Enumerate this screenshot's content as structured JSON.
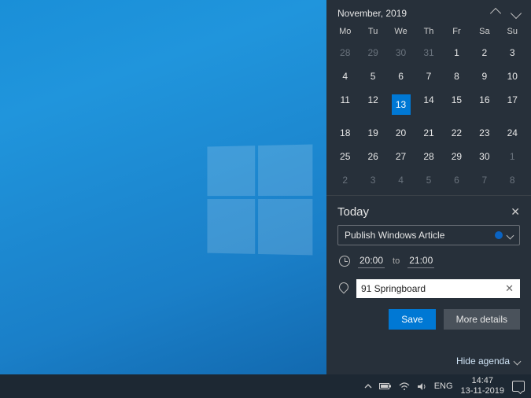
{
  "calendar": {
    "month_label": "November, 2019",
    "dow": [
      "Mo",
      "Tu",
      "We",
      "Th",
      "Fr",
      "Sa",
      "Su"
    ],
    "weeks": [
      [
        {
          "n": 28,
          "dim": true
        },
        {
          "n": 29,
          "dim": true
        },
        {
          "n": 30,
          "dim": true
        },
        {
          "n": 31,
          "dim": true
        },
        {
          "n": 1
        },
        {
          "n": 2
        },
        {
          "n": 3
        }
      ],
      [
        {
          "n": 4
        },
        {
          "n": 5
        },
        {
          "n": 6
        },
        {
          "n": 7
        },
        {
          "n": 8
        },
        {
          "n": 9
        },
        {
          "n": 10
        }
      ],
      [
        {
          "n": 11
        },
        {
          "n": 12
        },
        {
          "n": 13,
          "sel": true
        },
        {
          "n": 14
        },
        {
          "n": 15
        },
        {
          "n": 16
        },
        {
          "n": 17
        }
      ],
      [
        {
          "n": 18
        },
        {
          "n": 19
        },
        {
          "n": 20
        },
        {
          "n": 21
        },
        {
          "n": 22
        },
        {
          "n": 23
        },
        {
          "n": 24
        }
      ],
      [
        {
          "n": 25
        },
        {
          "n": 26
        },
        {
          "n": 27
        },
        {
          "n": 28
        },
        {
          "n": 29
        },
        {
          "n": 30
        },
        {
          "n": 1,
          "dim": true
        }
      ],
      [
        {
          "n": 2,
          "dim": true
        },
        {
          "n": 3,
          "dim": true
        },
        {
          "n": 4,
          "dim": true
        },
        {
          "n": 5,
          "dim": true
        },
        {
          "n": 6,
          "dim": true
        },
        {
          "n": 7,
          "dim": true
        },
        {
          "n": 8,
          "dim": true
        }
      ]
    ]
  },
  "event": {
    "heading": "Today",
    "title": "Publish Windows Article",
    "start": "20:00",
    "to": "to",
    "end": "21:00",
    "location": "91 Springboard",
    "save": "Save",
    "more": "More details",
    "hide": "Hide agenda"
  },
  "taskbar": {
    "lang": "ENG",
    "time": "14:47",
    "date": "13-11-2019"
  }
}
